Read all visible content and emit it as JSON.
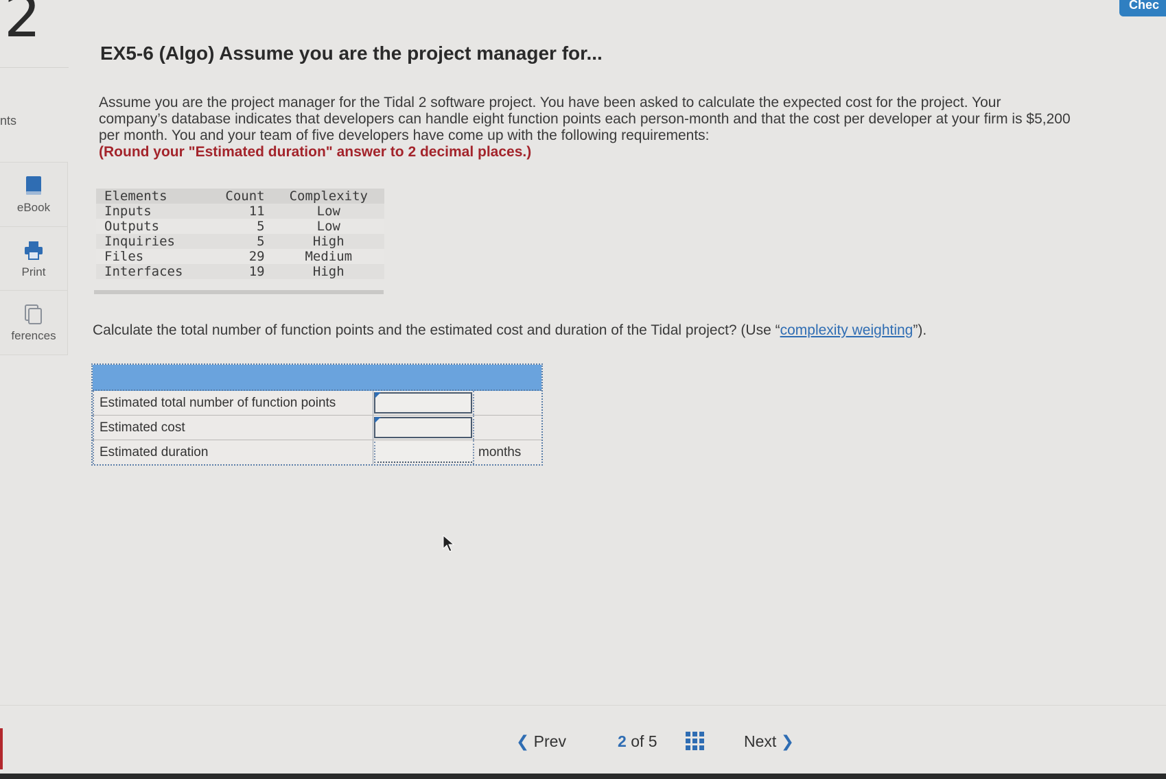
{
  "question_number": "2",
  "sidebar": {
    "points_label": "nts",
    "items": [
      {
        "label": "eBook",
        "icon": "ebook-icon"
      },
      {
        "label": "Print",
        "icon": "printer-icon"
      },
      {
        "label": "ferences",
        "icon": "references-icon"
      }
    ]
  },
  "header": {
    "check_label": "Chec"
  },
  "problem": {
    "title": "EX5-6 (Algo) Assume you are the project manager for...",
    "prompt": "Assume you are the project manager for the Tidal 2 software project. You have been asked to calculate the expected cost for the project. Your company’s database indicates that developers can handle eight function points each person-month and that the cost per developer at your firm is $5,200 per month. You and your team of five developers have come up with the following requirements:",
    "instruction": "(Round your \"Estimated duration\" answer to 2 decimal places.)",
    "requirements": {
      "headers": [
        "Elements",
        "Count",
        "Complexity"
      ],
      "rows": [
        {
          "element": "Inputs",
          "count": "11",
          "complexity": "Low"
        },
        {
          "element": "Outputs",
          "count": "5",
          "complexity": "Low"
        },
        {
          "element": "Inquiries",
          "count": "5",
          "complexity": "High"
        },
        {
          "element": "Files",
          "count": "29",
          "complexity": "Medium"
        },
        {
          "element": "Interfaces",
          "count": "19",
          "complexity": "High"
        }
      ]
    },
    "question_before": "Calculate the total number of function points and the estimated cost and duration of the Tidal project? (Use “",
    "question_link": "complexity weighting",
    "question_after": "”)."
  },
  "answer": {
    "rows": [
      {
        "label": "Estimated total number of function points",
        "value": "",
        "unit": ""
      },
      {
        "label": "Estimated cost",
        "value": "",
        "unit": ""
      },
      {
        "label": "Estimated duration",
        "value": "",
        "unit": "months"
      }
    ]
  },
  "nav": {
    "prev": "Prev",
    "current": "2",
    "of": "of 5",
    "next": "Next"
  },
  "colors": {
    "accent": "#2f6db3",
    "answer_header": "#6aa3dd",
    "emphasis": "#a3242b"
  }
}
